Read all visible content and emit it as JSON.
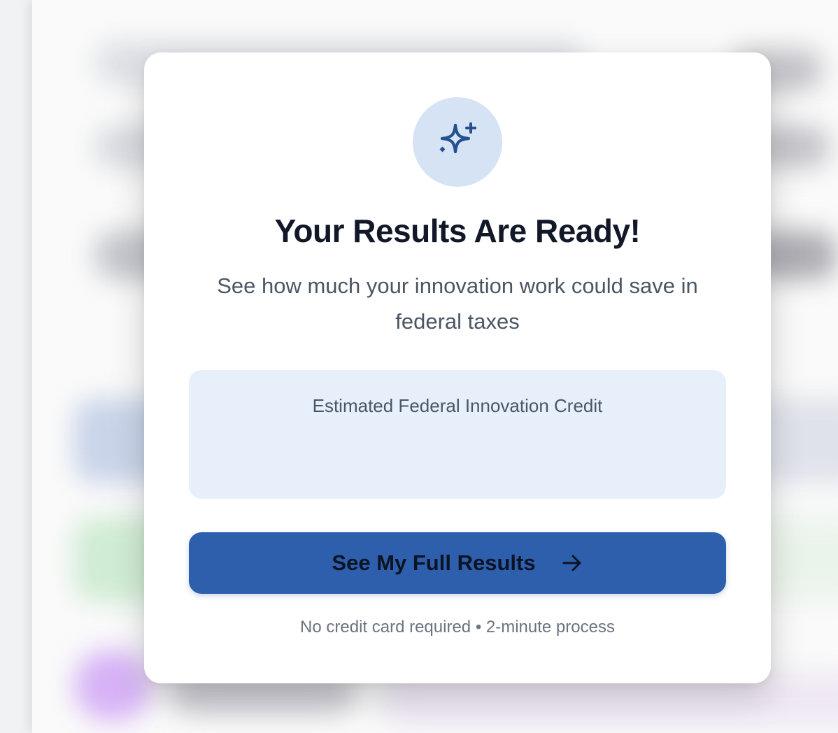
{
  "modal": {
    "icon": "sparkles-icon",
    "title": "Your Results Are Ready!",
    "subtitle": "See how much your innovation work could save in federal taxes",
    "credit_label": "Estimated Federal Innovation Credit",
    "cta_label": "See My Full Results",
    "cta_icon": "arrow-right-icon",
    "footnote": "No credit card required • 2-minute process"
  },
  "colors": {
    "accent": "#2d5fac",
    "icon_circle_bg": "#d6e3f5",
    "icon_stroke": "#24508f",
    "credit_box_bg": "#e7effb",
    "title_text": "#111827"
  }
}
